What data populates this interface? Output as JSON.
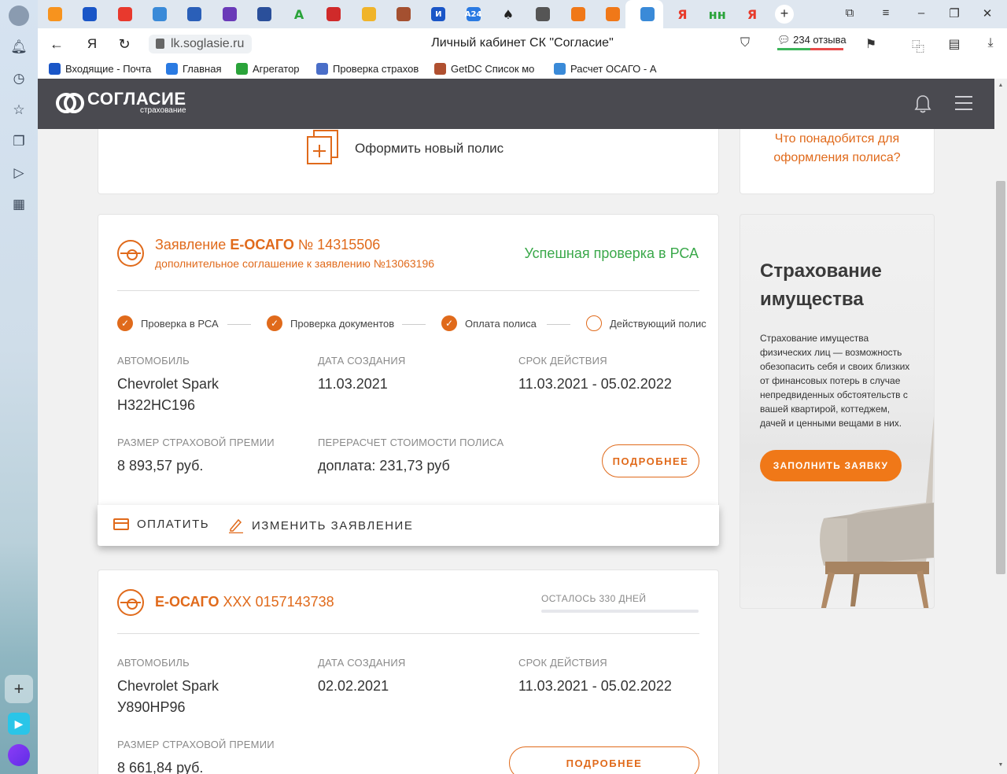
{
  "browser": {
    "page_title": "Личный кабинет СК \"Согласие\"",
    "url": "lk.soglasie.ru",
    "reviews": "234 отзыва",
    "yandex_label": "Я",
    "bookmarks": [
      {
        "label": "Входящие - Почта",
        "icon": "mail-icon",
        "color": "#1a56c7"
      },
      {
        "label": "Главная",
        "icon": "a24-icon",
        "color": "#2a7ae2"
      },
      {
        "label": "Агрегатор",
        "icon": "green-a-icon",
        "color": "#2aa33a"
      },
      {
        "label": "Проверка страхов",
        "icon": "globe-icon",
        "color": "#4a6ec8"
      },
      {
        "label": "GetDC Список мо",
        "icon": "car-icon",
        "color": "#b05030"
      },
      {
        "label": "Расчет ОСАГО - А",
        "icon": "yoga-icon",
        "color": "#3a8ad8"
      }
    ],
    "tab_icons": [
      "ok-icon",
      "mail-icon",
      "pocket-icon",
      "drive-icon",
      "flag-icon",
      "shield-icon",
      "globe-icon",
      "green-a-icon",
      "russia-flag-icon",
      "yandex-mail-icon",
      "car-icon",
      "i-icon",
      "a24-icon",
      "spades-icon",
      "document-icon",
      "soglasie-icon",
      "soglasie-icon",
      "yoga-icon",
      "yandex-icon",
      "hh-icon",
      "yandex-icon"
    ],
    "tab_letters": [
      "",
      "",
      "",
      "",
      "",
      "",
      "",
      "A",
      "",
      "",
      "",
      "И",
      "A24",
      "♠",
      "",
      "",
      "",
      "",
      "Я",
      "нн",
      "Я"
    ]
  },
  "site": {
    "logo_name": "СОГЛАСИЕ",
    "logo_sub": "страхование"
  },
  "new_policy": {
    "label": "Оформить новый полис"
  },
  "need_info": {
    "text": "Что понадобится для оформления полиса?"
  },
  "application": {
    "title_prefix": "Заявление",
    "title_product": "Е-ОСАГО",
    "title_number": "№ 14315506",
    "subtitle": "дополнительное соглашение к заявлению №13063196",
    "status": "Успешная проверка в РСА",
    "steps": [
      {
        "label": "Проверка в РСА",
        "done": true
      },
      {
        "label": "Проверка документов",
        "done": true
      },
      {
        "label": "Оплата полиса",
        "done": true
      },
      {
        "label": "Действующий полис",
        "done": false
      }
    ],
    "car_label": "АВТОМОБИЛЬ",
    "car_model": "Chevrolet Spark",
    "car_plate": "Н322НС196",
    "created_label": "ДАТА СОЗДАНИЯ",
    "created": "11.03.2021",
    "period_label": "СРОК ДЕЙСТВИЯ",
    "period": "11.03.2021 - 05.02.2022",
    "premium_label": "РАЗМЕР СТРАХОВОЙ ПРЕМИИ",
    "premium": "8 893,57 руб.",
    "recalc_label": "ПЕРЕРАСЧЕТ СТОИМОСТИ ПОЛИСА",
    "recalc": "доплата: 231,73 руб",
    "details_button": "ПОДРОБНЕЕ",
    "pay_button": "ОПЛАТИТЬ",
    "edit_button": "ИЗМЕНИТЬ ЗАЯВЛЕНИЕ"
  },
  "promo": {
    "title": "Страхование имущества",
    "text": "Страхование имущества физических лиц — возможность обезопасить себя и своих близких от финансовых потерь в случае непредвиденных обстоятельств с вашей квартирой, коттеджем, дачей и ценными вещами в них.",
    "button": "ЗАПОЛНИТЬ ЗАЯВКУ"
  },
  "policy": {
    "product": "Е-ОСАГО",
    "number": "ХХХ 0157143738",
    "days_left": "ОСТАЛОСЬ 330 ДНЕЙ",
    "days_progress": 0.9,
    "car_label": "АВТОМОБИЛЬ",
    "car_model": "Chevrolet Spark",
    "car_plate": "У890НР96",
    "created_label": "ДАТА СОЗДАНИЯ",
    "created": "02.02.2021",
    "period_label": "СРОК ДЕЙСТВИЯ",
    "period": "11.03.2021 - 05.02.2022",
    "premium_label": "РАЗМЕР СТРАХОВОЙ ПРЕМИИ",
    "premium": "8 661,84 руб.",
    "details_button": "ПОДРОБНЕЕ"
  },
  "colors": {
    "accent": "#e06a1b",
    "success": "#3aa84a",
    "header": "#4a4a50",
    "promo_button": "#f07818"
  }
}
